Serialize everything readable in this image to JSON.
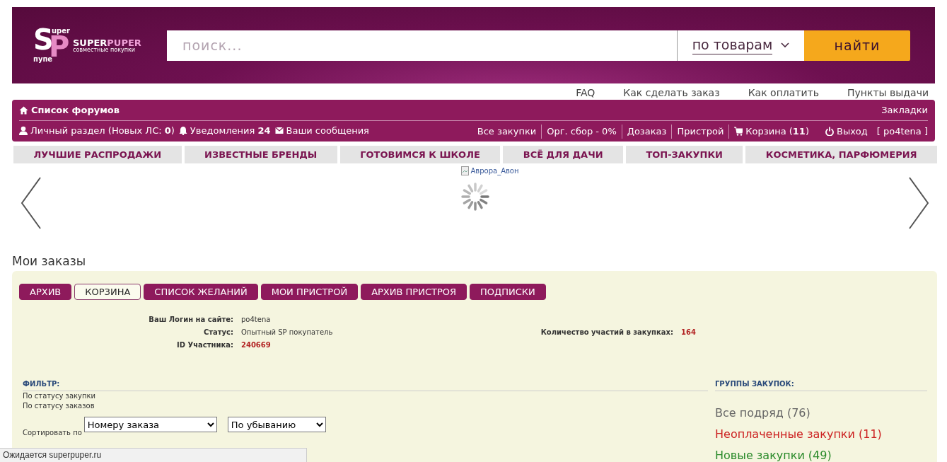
{
  "header": {
    "logo": {
      "letter_1": "S",
      "letter_2": "P",
      "top": "uper",
      "bottom": "пупе",
      "name_1": "SUPER",
      "name_2": "PUPER",
      "tagline": "совместные покупки"
    },
    "search": {
      "placeholder": "поиск...",
      "scope": "по товарам",
      "button": "найти"
    }
  },
  "top_links": [
    "FAQ",
    "Как сделать заказ",
    "Как оплатить",
    "Пункты выдачи"
  ],
  "nav": {
    "forums": "Список форумов",
    "bookmarks": "Закладки",
    "left_items": [
      {
        "kind": "user",
        "label": "Личный раздел (Новых ЛС: **0**)"
      },
      {
        "kind": "bell",
        "label": "Уведомления **24**"
      },
      {
        "kind": "mail",
        "label": "Ваши сообщения"
      }
    ],
    "right_items": [
      {
        "kind": "link",
        "label": "Все закупки"
      },
      {
        "kind": "link",
        "label": "Орг. сбор - 0%"
      },
      {
        "kind": "link",
        "label": "Дозаказ"
      },
      {
        "kind": "link",
        "label": "Пристрой"
      },
      {
        "kind": "cart",
        "label": "Корзина (**11**)"
      },
      {
        "kind": "logout",
        "label": "Выход"
      },
      {
        "kind": "plain",
        "label": "[ po4tena ]"
      }
    ]
  },
  "categories": [
    "ЛУЧШИЕ РАСПРОДАЖИ",
    "ИЗВЕСТНЫЕ БРЕНДЫ",
    "ГОТОВИМСЯ К ШКОЛЕ",
    "ВСЁ ДЛЯ ДАЧИ",
    "ТОП-ЗАКУПКИ",
    "КОСМЕТИКА, ПАРФЮМЕРИЯ"
  ],
  "carousel": {
    "image_alt": "Аврора_Авон"
  },
  "orders": {
    "title": "Мои заказы",
    "tabs": [
      {
        "label": "АРХИВ",
        "selected": false
      },
      {
        "label": "КОРЗИНА",
        "selected": true
      },
      {
        "label": "СПИСОК ЖЕЛАНИЙ",
        "selected": false
      },
      {
        "label": "МОИ ПРИСТРОЙ",
        "selected": false
      },
      {
        "label": "АРХИВ ПРИСТРОЯ",
        "selected": false
      },
      {
        "label": "ПОДПИСКИ",
        "selected": false
      }
    ],
    "profile": [
      {
        "label": "Ваш Логин на сайте:",
        "value": "po4tena",
        "kind": "plain"
      },
      {
        "label": "Статус:",
        "value": "Опытный SP покупатель",
        "kind": "plain"
      },
      {
        "label": "ID Участника:",
        "value": "240669",
        "kind": "highlight"
      }
    ],
    "participation": {
      "label": "Количество участий в закупках:",
      "value": "164"
    },
    "filter": {
      "heading": "ФИЛЬТР:",
      "lines": [
        "По статусу закупки",
        "По статусу заказов"
      ],
      "sort_label": "Сортировать по",
      "selects": [
        "Номеру заказа",
        "По убыванию"
      ]
    },
    "groups": {
      "heading": "ГРУППЫ ЗАКУПОК:",
      "items": [
        {
          "label": "Все подряд (76)",
          "color": "#666666"
        },
        {
          "label": "Неоплаченные закупки (11)",
          "color": "#cc2020"
        },
        {
          "label": "Новые закупки (49)",
          "color": "#2a8a2a"
        }
      ]
    }
  },
  "status_bar": "Ожидается superpuper.ru"
}
